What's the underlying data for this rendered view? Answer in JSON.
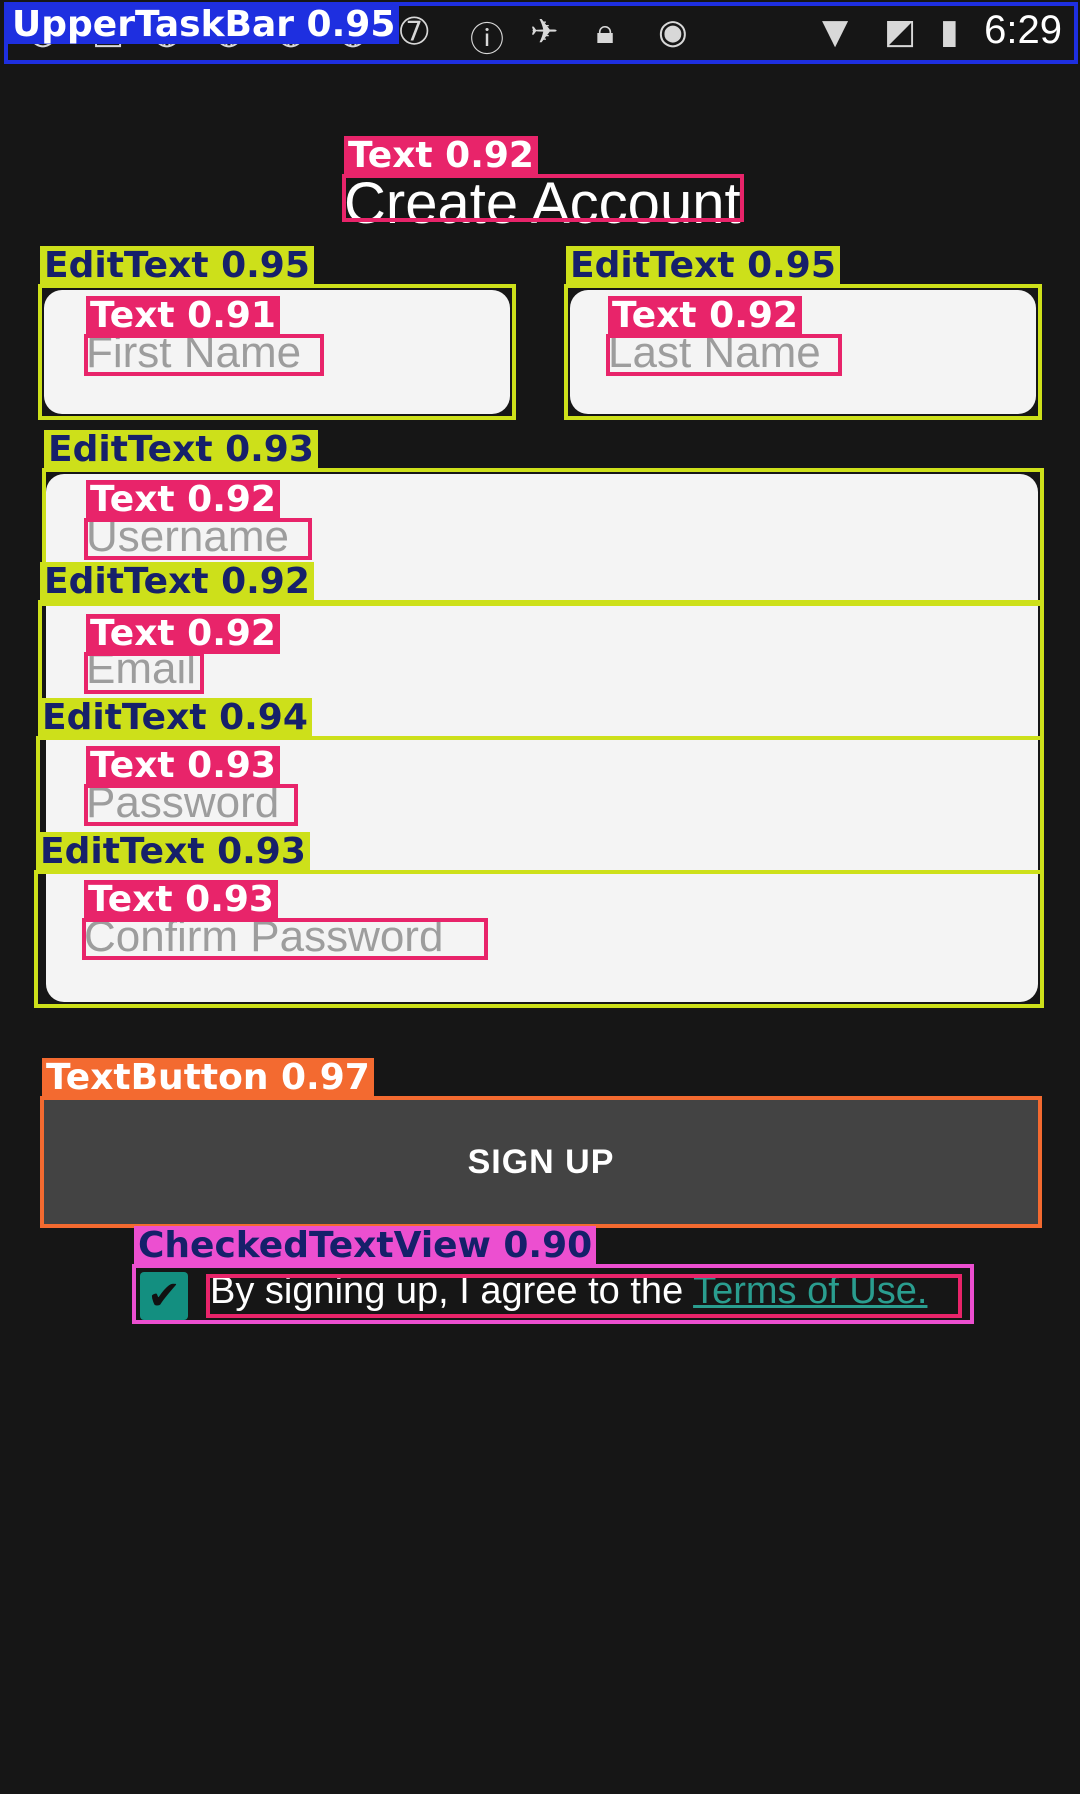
{
  "status_bar": {
    "time": "6:29",
    "icons": [
      "abc-news-icon",
      "abc-news-icon",
      "abc-news-icon",
      "abc-news-icon",
      "abc-news-icon",
      "abc-news-icon",
      "abc-7-icon",
      "info-circle-icon",
      "satellite-icon",
      "lock-icon",
      "android-icon",
      "wifi-icon",
      "no-sim-icon",
      "battery-charging-icon"
    ]
  },
  "form": {
    "title": "Create Account",
    "first_name_placeholder": "First Name",
    "last_name_placeholder": "Last Name",
    "username_placeholder": "Username",
    "email_placeholder": "Email",
    "password_placeholder": "Password",
    "confirm_password_placeholder": "Confirm Password",
    "signup_label": "SIGN UP",
    "terms_prefix": "By signing up, I agree to the ",
    "terms_link": "Terms of Use.",
    "terms_checked": true
  },
  "detections": {
    "upper_taskbar": "UpperTaskBar 0.95",
    "title_text": "Text 0.92",
    "first_name_edit": "EditText 0.95",
    "first_name_text": "Text 0.91",
    "last_name_edit": "EditText 0.95",
    "last_name_text": "Text 0.92",
    "username_edit": "EditText 0.93",
    "username_text": "Text 0.92",
    "email_edit": "EditText 0.92",
    "email_text": "Text 0.92",
    "password_edit": "EditText 0.94",
    "password_text": "Text 0.93",
    "confirm_edit": "EditText 0.93",
    "confirm_text": "Text 0.93",
    "signup_button": "TextButton 0.97",
    "checked_text_view": "CheckedTextView 0.90"
  },
  "colors": {
    "background": "#161616",
    "field": "#f4f4f4",
    "button": "#434343",
    "accent": "#138f80",
    "link": "#2a9d8f"
  }
}
